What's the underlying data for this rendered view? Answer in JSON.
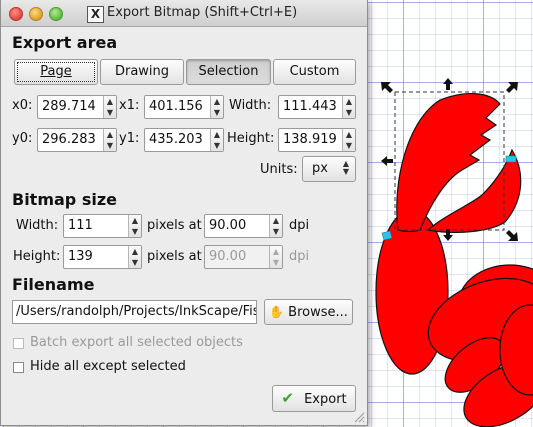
{
  "window": {
    "title": "Export Bitmap (Shift+Ctrl+E)",
    "app_icon": "X"
  },
  "export_area": {
    "heading": "Export area",
    "buttons": [
      "Page",
      "Drawing",
      "Selection",
      "Custom"
    ],
    "selected": "Selection",
    "x0_label": "x0:",
    "x0": "289.714",
    "x1_label": "x1:",
    "x1": "401.156",
    "width_label": "Width:",
    "width": "111.443",
    "y0_label": "y0:",
    "y0": "296.283",
    "y1_label": "y1:",
    "y1": "435.203",
    "height_label": "Height:",
    "height": "138.919",
    "units_label": "Units:",
    "units": "px"
  },
  "bitmap_size": {
    "heading": "Bitmap size",
    "width_label": "Width:",
    "width": "111",
    "pixels_at_1": "pixels at",
    "dpi_1": "90.00",
    "dpi_unit_1": "dpi",
    "height_label": "Height:",
    "height": "139",
    "pixels_at_2": "pixels at",
    "dpi_2": "90.00",
    "dpi_unit_2": "dpi"
  },
  "filename": {
    "heading": "Filename",
    "path": "/Users/randolph/Projects/InkScape/Fis",
    "browse_label": "Browse..."
  },
  "options": {
    "batch_label": "Batch export all selected objects",
    "hide_label": "Hide all except selected"
  },
  "export_button": "Export",
  "colors": {
    "shape_fill": "#ff0000",
    "grid_line": "#8c96e6",
    "handle_color": "#111111",
    "rotate_handle": "#27c6e8"
  },
  "icons": {
    "export": "checkmark-icon",
    "browse": "folder-hand-icon"
  }
}
